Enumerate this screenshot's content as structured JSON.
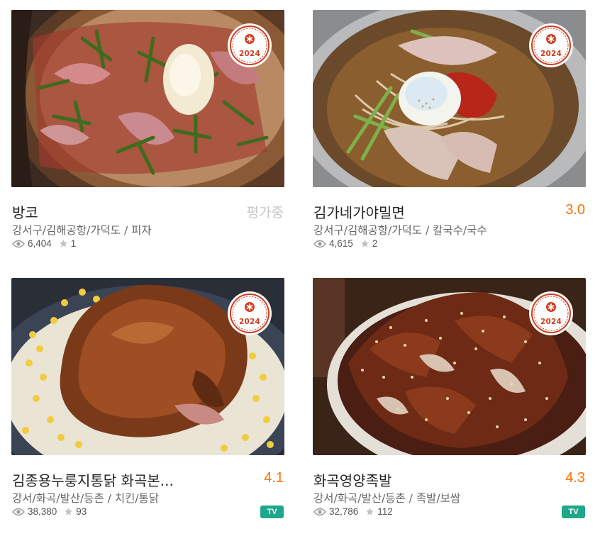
{
  "badge_year": "2024",
  "restaurants": [
    {
      "name": "방코",
      "score": "평가중",
      "location": "강서구/김해공항/가덕도",
      "category": "피자",
      "separator": " / ",
      "views": "6,404",
      "reviews": "1",
      "tv_label": ""
    },
    {
      "name": "김가네가야밀면",
      "score": "3.0",
      "location": "강서구/김해공항/가덕도",
      "category": "칼국수/국수",
      "separator": " / ",
      "views": "4,615",
      "reviews": "2",
      "tv_label": ""
    },
    {
      "name": "김종용누룽지통닭 화곡본...",
      "score": "4.1",
      "location": "강서/화곡/발산/등촌",
      "category": "치킨/통닭",
      "separator": " / ",
      "views": "38,380",
      "reviews": "93",
      "tv_label": "TV"
    },
    {
      "name": "화곡영양족발",
      "score": "4.3",
      "location": "강서/화곡/발산/등촌",
      "category": "족발/보쌈",
      "separator": " / ",
      "views": "32,786",
      "reviews": "112",
      "tv_label": "TV"
    }
  ],
  "colors": {
    "score": "#ff7100",
    "pending": "#c7c7c7",
    "badge": "#d23c1e",
    "tv": "#1fa78a"
  }
}
